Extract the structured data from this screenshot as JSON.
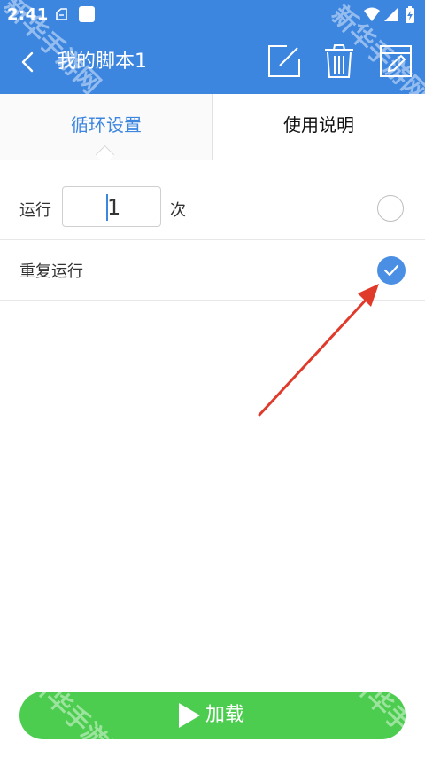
{
  "status_bar": {
    "time": "2:41",
    "icons": [
      "notification-icon",
      "square-icon",
      "wifi-icon",
      "signal-icon",
      "battery-charging-icon"
    ]
  },
  "app_bar": {
    "title": "我的脚本1",
    "icons": [
      "back-icon",
      "edit-icon",
      "delete-icon",
      "rename-icon"
    ]
  },
  "tabs": [
    {
      "label": "循环设置",
      "active": true
    },
    {
      "label": "使用说明",
      "active": false
    }
  ],
  "options": {
    "run_label": "运行",
    "run_count": "1",
    "run_unit": "次",
    "run_selected": false,
    "repeat_label": "重复运行",
    "repeat_selected": true
  },
  "load_button": {
    "label": "加载",
    "icon": "play-icon"
  },
  "watermark": {
    "text": "新华手游网"
  },
  "colors": {
    "primary": "#3d86e0",
    "radio_selected": "#4a8fe4",
    "load_button": "#4ccd4f",
    "annotation": "#e03a2b"
  }
}
